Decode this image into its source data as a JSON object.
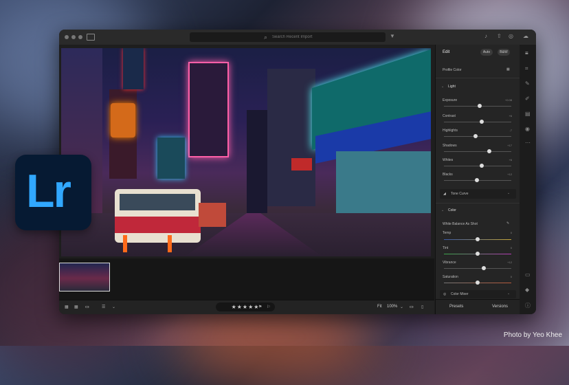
{
  "window": {
    "search_placeholder": "Search Recent Import"
  },
  "editor": {
    "title": "Edit",
    "mode_auto": "Auto",
    "mode_bw": "B&W",
    "profile": "Profile  Color",
    "light": {
      "title": "Light",
      "sliders": [
        {
          "label": "Exposure",
          "value": "+0.08",
          "level": 0.52
        },
        {
          "label": "Contrast",
          "value": "+6",
          "level": 0.55
        },
        {
          "label": "Highlights",
          "value": "-7",
          "level": 0.46
        },
        {
          "label": "Shadows",
          "value": "+17",
          "level": 0.67
        },
        {
          "label": "Whites",
          "value": "+6",
          "level": 0.55
        },
        {
          "label": "Blacks",
          "value": "+12",
          "level": 0.48
        }
      ],
      "tone_curve": "Tone Curve"
    },
    "color": {
      "title": "Color",
      "white_balance": "White Balance  As Shot",
      "sliders": [
        {
          "label": "Temp",
          "value": "0",
          "level": 0.5
        },
        {
          "label": "Tint",
          "value": "0",
          "level": 0.5
        },
        {
          "label": "Vibrance",
          "value": "+12",
          "level": 0.56
        },
        {
          "label": "Saturation",
          "value": "0",
          "level": 0.5
        }
      ],
      "color_mixer": "Color Mixer"
    },
    "tabs": {
      "presets": "Presets",
      "versions": "Versions"
    }
  },
  "toolbar": {
    "stars": "★★★★★",
    "fit": "Fit",
    "zoom": "100%"
  },
  "app_logo": "Lr",
  "credit": "Photo by Yeo Khee"
}
